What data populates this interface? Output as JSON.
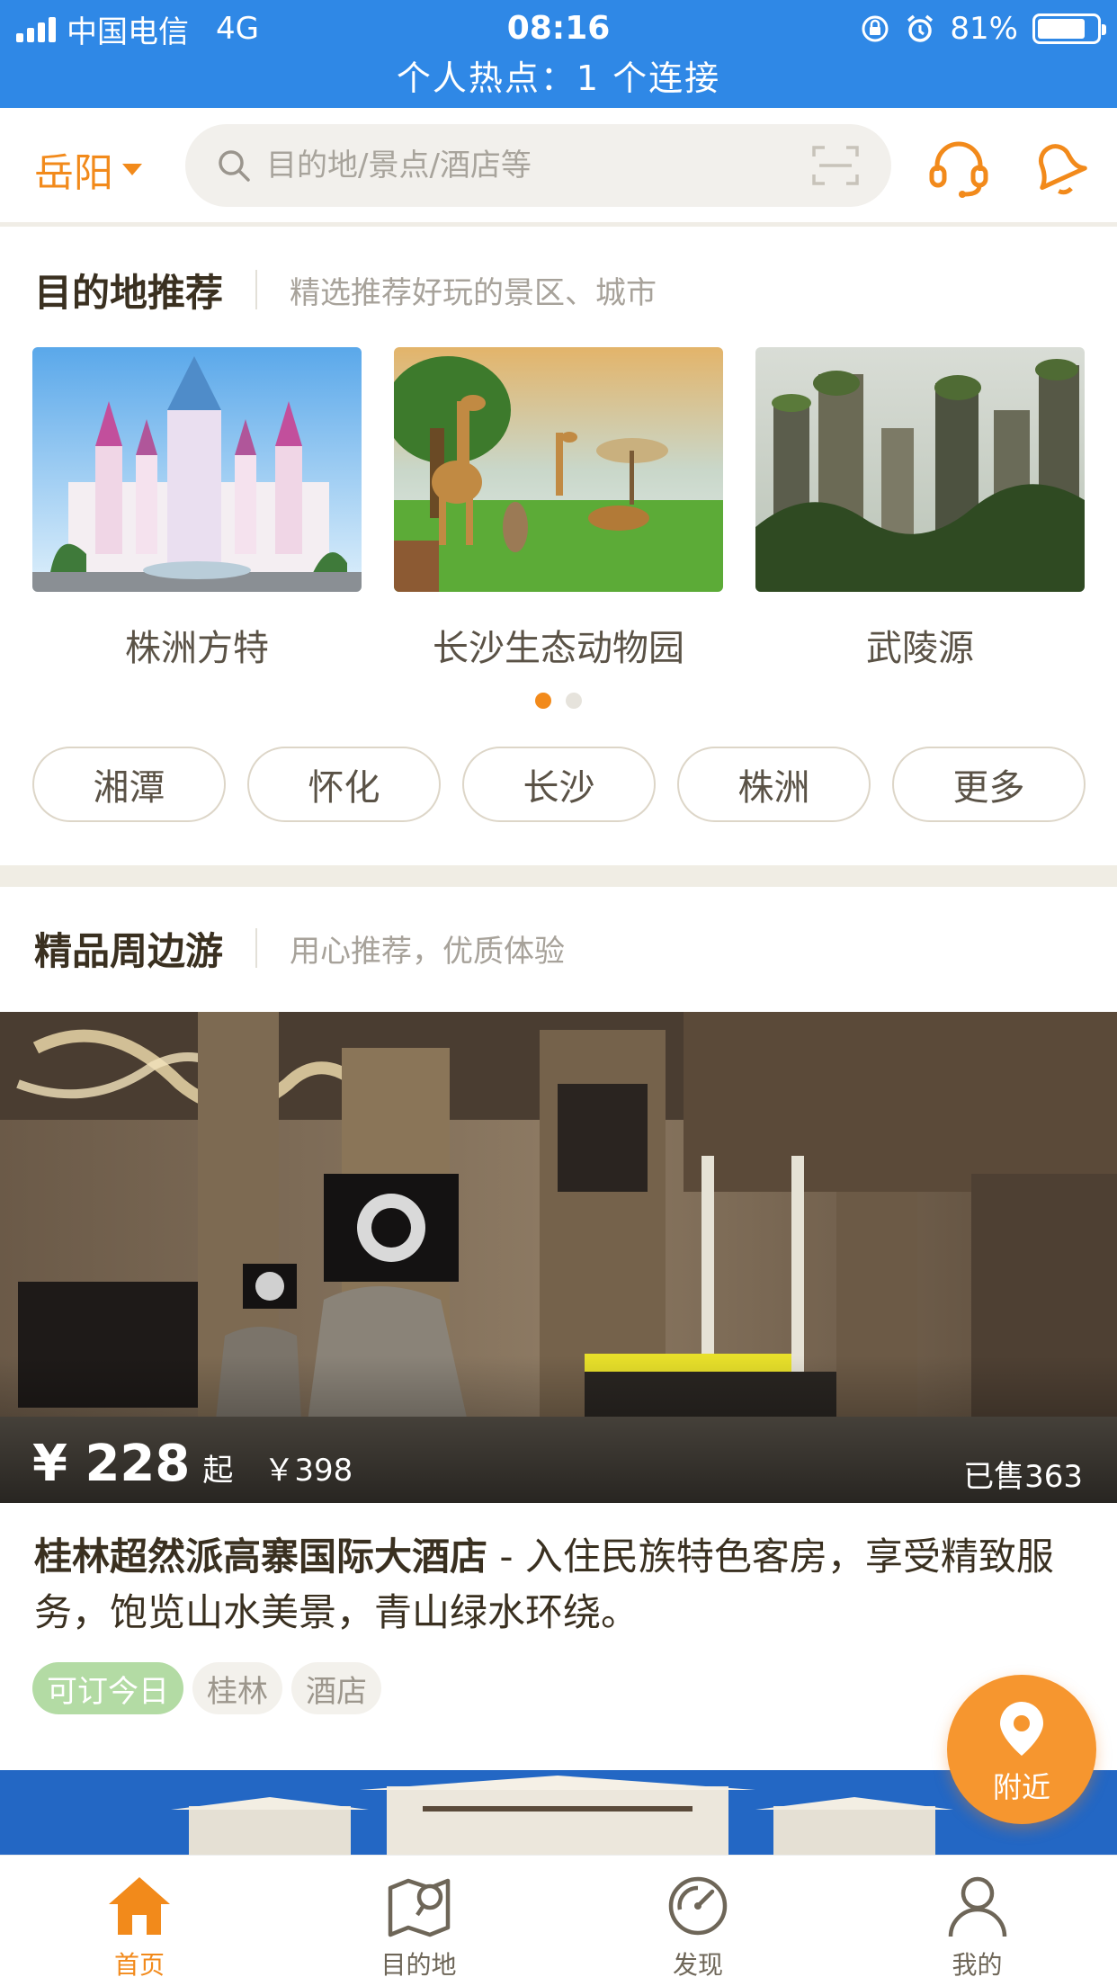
{
  "status_bar": {
    "carrier": "中国电信",
    "network": "4G",
    "time": "08:16",
    "battery": "81%",
    "battery_level": 0.81,
    "hotspot": "个人热点：1 个连接"
  },
  "header": {
    "city": "岳阳",
    "search_placeholder": "目的地/景点/酒店等"
  },
  "destinations": {
    "title": "目的地推荐",
    "subtitle": "精选推荐好玩的景区、城市",
    "items": [
      {
        "name": "株洲方特"
      },
      {
        "name": "长沙生态动物园"
      },
      {
        "name": "武陵源"
      }
    ],
    "page_count": 2,
    "current_page": 1,
    "chips": [
      "湘潭",
      "怀化",
      "长沙",
      "株洲",
      "更多"
    ]
  },
  "tours": {
    "title": "精品周边游",
    "subtitle": "用心推荐，优质体验",
    "product": {
      "price": "¥ 228",
      "price_suffix": "起",
      "original_price": "￥398",
      "sold": "已售363",
      "name": "桂林超然派高寨国际大酒店",
      "description": " - 入住民族特色客房，享受精致服务，饱览山水美景，青山绿水环绕。",
      "tags": [
        "可订今日",
        "桂林",
        "酒店"
      ]
    }
  },
  "nearby_button": {
    "label": "附近"
  },
  "tab_bar": {
    "items": [
      {
        "label": "首页",
        "icon": "home-icon",
        "active": true
      },
      {
        "label": "目的地",
        "icon": "map-icon",
        "active": false
      },
      {
        "label": "发现",
        "icon": "compass-icon",
        "active": false
      },
      {
        "label": "我的",
        "icon": "profile-icon",
        "active": false
      }
    ]
  },
  "colors": {
    "status_bar": "#2f88e6",
    "accent": "#f28a1b",
    "tag_green": "#b3dba4"
  }
}
